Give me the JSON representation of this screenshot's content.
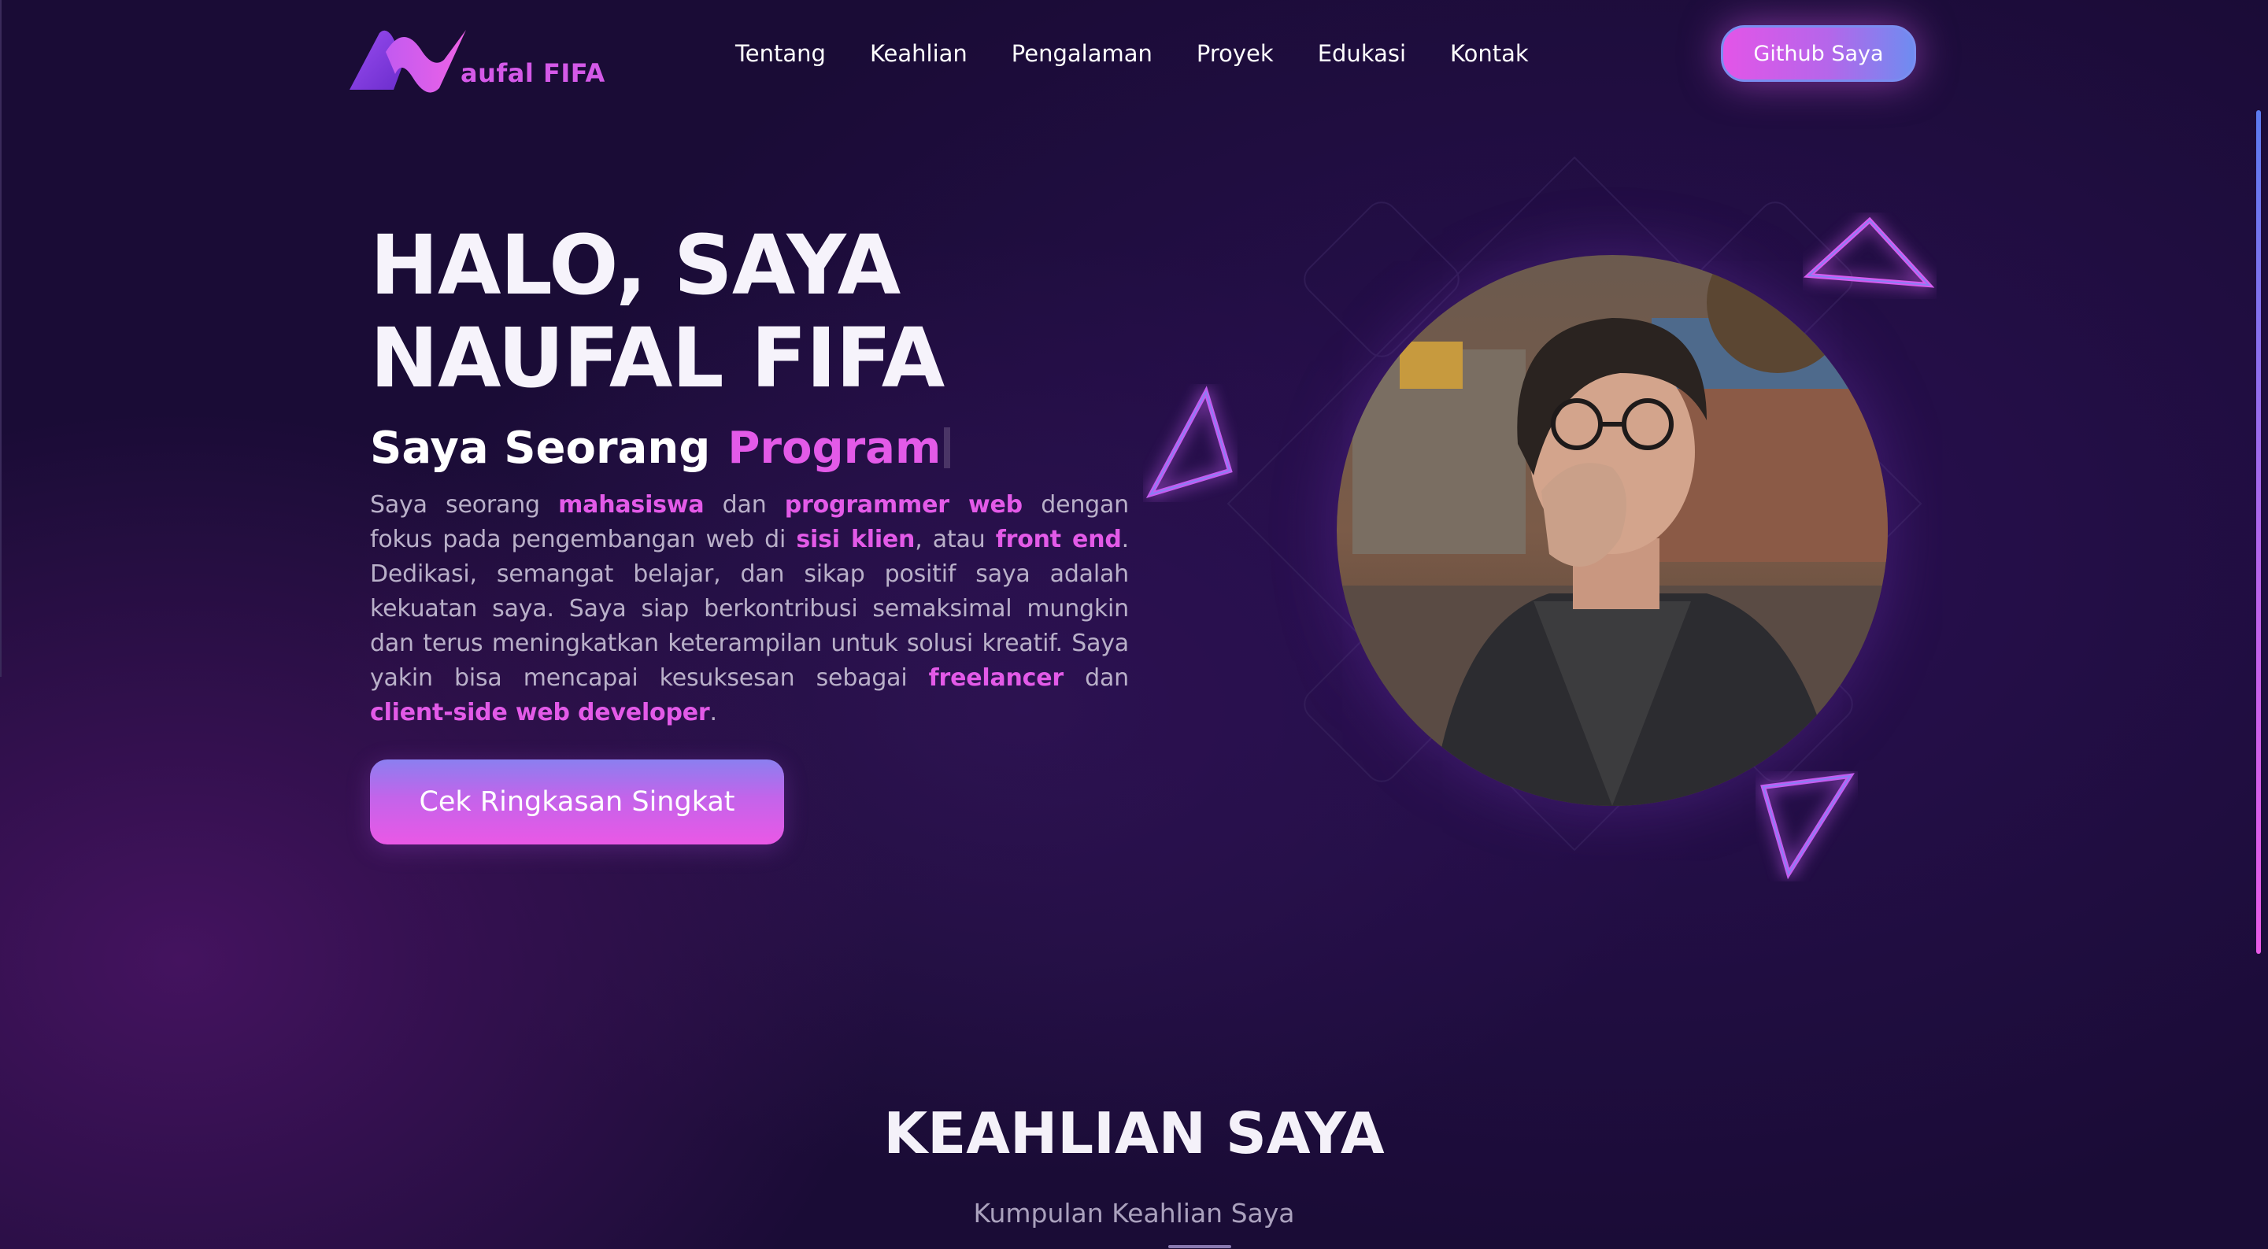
{
  "nav": {
    "logo_text": "aufal FIFA",
    "menu": [
      {
        "label": "Tentang"
      },
      {
        "label": "Keahlian"
      },
      {
        "label": "Pengalaman"
      },
      {
        "label": "Proyek"
      },
      {
        "label": "Edukasi"
      },
      {
        "label": "Kontak"
      }
    ],
    "github_label": "Github Saya"
  },
  "hero": {
    "title_line1": "HALO, SAYA",
    "title_line2": "NAUFAL FIFA",
    "subtitle_lead": "Saya Seorang",
    "subtitle_typed": "Program",
    "bio": {
      "p1": "Saya seorang ",
      "h1": "mahasiswa",
      "p2": " dan ",
      "h2": "programmer web",
      "p3": " dengan fokus pada pengembangan web di ",
      "h3": "sisi klien",
      "p4": ", atau ",
      "h4": "front end",
      "p5": ". Dedikasi, semangat belajar, dan sikap positif saya adalah kekuatan saya. Saya siap berkontribusi semaksimal mungkin dan terus meningkatkan keterampilan untuk solusi kreatif. Saya yakin bisa mencapai kesuksesan sebagai ",
      "h5": "freelancer",
      "p6": " dan ",
      "h6": "client-side web developer",
      "p7": "."
    },
    "cta_label": "Cek Ringkasan Singkat",
    "photo_icon": "profile-photo"
  },
  "skills": {
    "title": "KEAHLIAN SAYA",
    "subtitle": "Kumpulan Keahlian Saya"
  },
  "colors": {
    "accent": "#e35ae8",
    "accent_blue": "#6f8cf0",
    "background": "#1a0c36"
  }
}
